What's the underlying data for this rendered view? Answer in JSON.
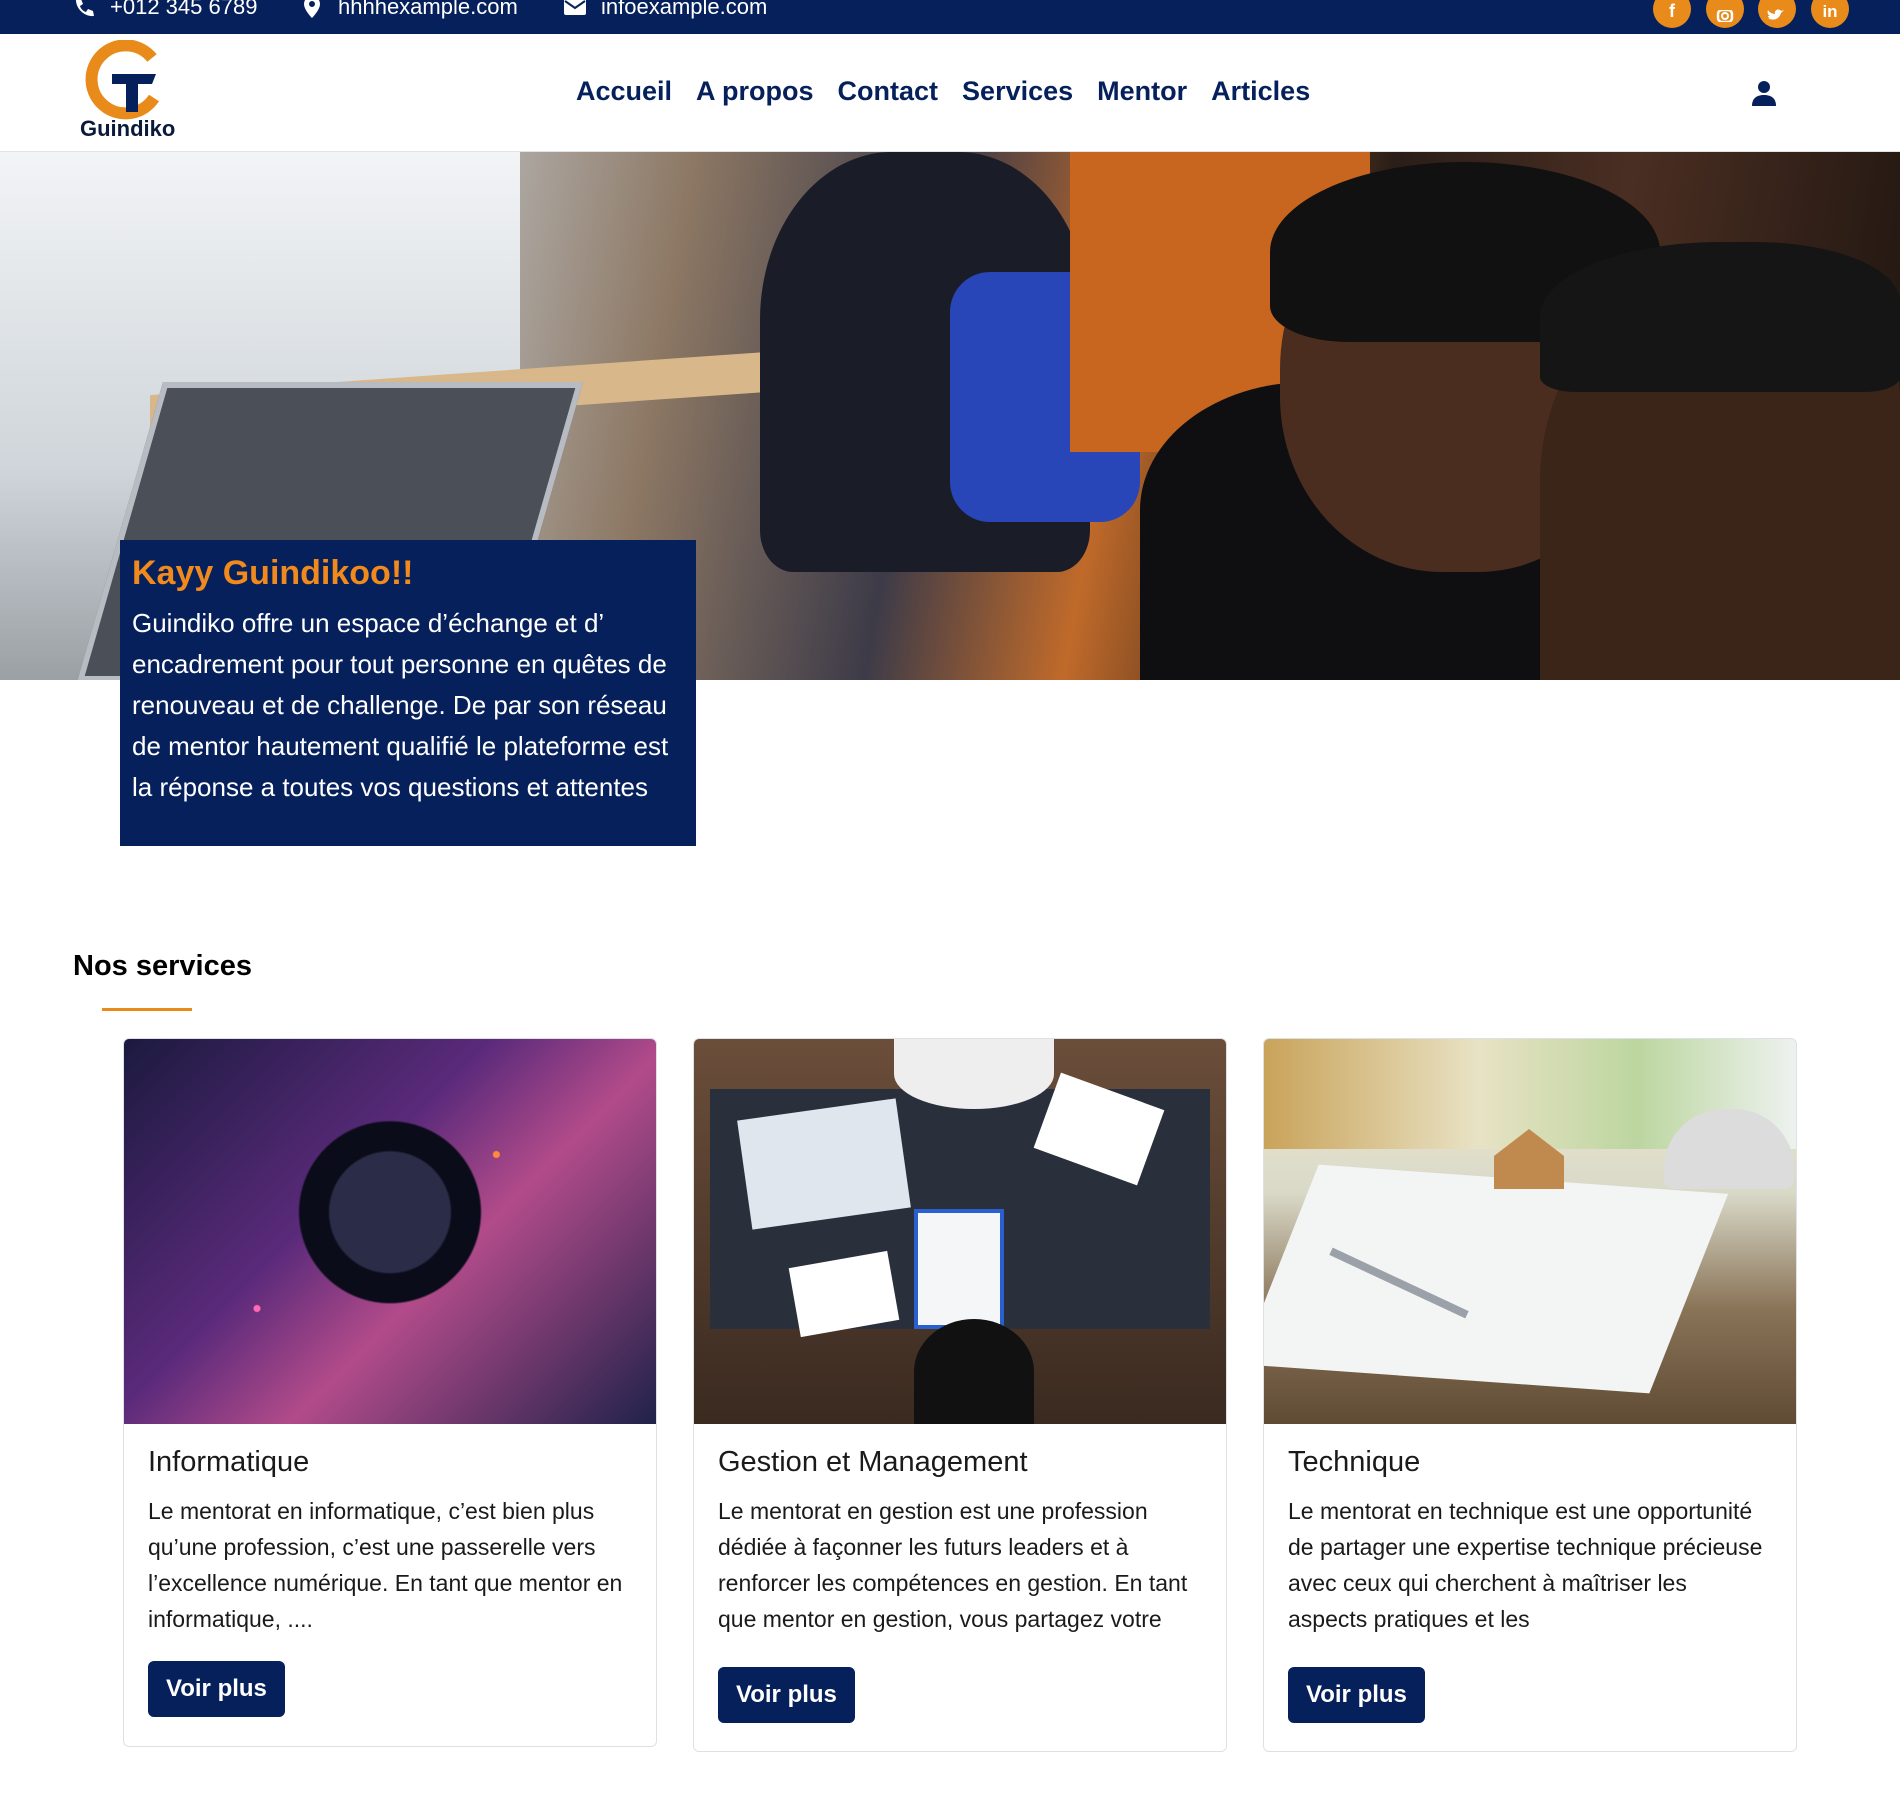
{
  "topbar": {
    "phone": "+012 345 6789",
    "address": "hhhhexample.com",
    "email": "infoexample.com",
    "social": [
      "f",
      "ig",
      "t",
      "in"
    ]
  },
  "brand": {
    "name": "Guindiko"
  },
  "nav": {
    "items": [
      "Accueil",
      "A propos",
      "Contact",
      "Services",
      "Mentor",
      "Articles"
    ]
  },
  "hero": {
    "title": "Kayy Guindikoo!!",
    "text": "Guindiko offre un espace d’échange et d’ encadrement pour tout personne en quêtes de renouveau et de challenge. De par son réseau de mentor hautement qualifié le plateforme est la réponse a toutes vos questions et attentes"
  },
  "services": {
    "title": "Nos services",
    "cards": [
      {
        "title": "Informatique",
        "text": " Le mentorat en informatique, c’est bien plus qu’une profession, c’est une passerelle vers l’excellence numérique. En tant que mentor en informatique, ....",
        "button": "Voir plus"
      },
      {
        "title": "Gestion et Management",
        "text": "Le mentorat en gestion est une profession dédiée à façonner les futurs leaders et à renforcer les compétences en gestion. En tant que mentor en gestion, vous partagez votre",
        "button": "Voir plus"
      },
      {
        "title": "Technique",
        "text": "Le mentorat en technique est une opportunité de partager une expertise technique précieuse avec ceux qui cherchent à maîtriser les aspects pratiques et les",
        "button": "Voir plus"
      }
    ]
  },
  "colors": {
    "navy": "#06205c",
    "orange": "#e88b1a"
  }
}
